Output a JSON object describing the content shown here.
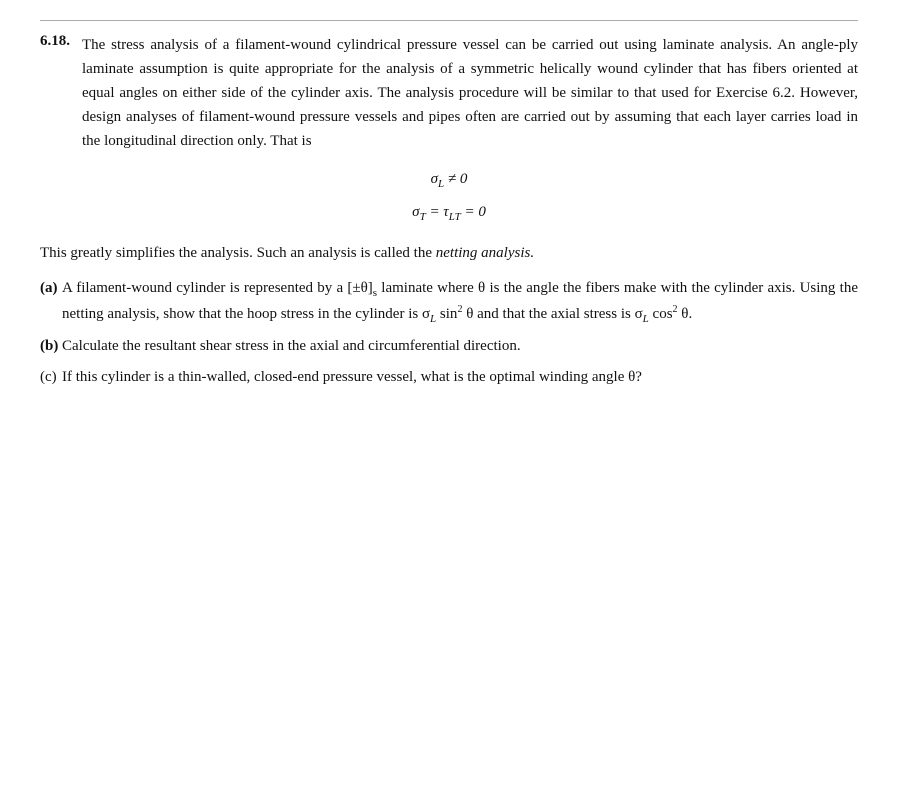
{
  "problem": {
    "number": "6.18.",
    "intro": "The stress analysis of a filament-wound cylindrical pressure vessel can be carried out using laminate analysis. An angle-ply laminate assumption is quite appropriate for the analysis of a symmetric helically wound cylinder that has fibers oriented at equal angles on either side of the cylinder axis. The analysis procedure will be similar to that used for Exercise 6.2. However, design analyses of filament-wound pressure vessels and pipes often are carried out by assuming that each layer carries load in the longitudinal direction only. That is",
    "equation1": "σ_L ≠ 0",
    "equation2": "σ_T = τ_LT = 0",
    "netting_text1": "This greatly simplifies the analysis. Such an analysis is called the",
    "netting_italic": "netting analysis.",
    "parts": [
      {
        "label": "(a)",
        "bold": false,
        "text": "A filament-wound cylinder is represented by a [±θ]s laminate where θ is the angle the fibers make with the cylinder axis. Using the netting analysis, show that the hoop stress in the cylinder is σ_L sin² θ and that the axial stress is σ_L cos² θ."
      },
      {
        "label": "(b)",
        "bold": true,
        "text": "Calculate the resultant shear stress in the axial and circumferential direction."
      },
      {
        "label": "(c)",
        "bold": false,
        "text": "If this cylinder is a thin-walled, closed-end pressure vessel, what is the optimal winding angle θ?"
      }
    ]
  }
}
